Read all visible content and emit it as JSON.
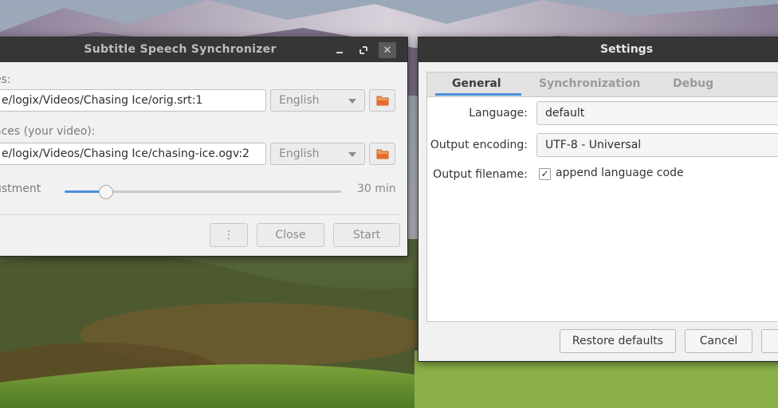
{
  "sync_window": {
    "title": "Subtitle Speech Synchronizer",
    "subtitles_label": "es:",
    "subtitles_path": "e/logix/Videos/Chasing Ice/orig.srt:1",
    "subtitles_language": "English",
    "references_label": "aces (your video):",
    "references_path": "e/logix/Videos/Chasing Ice/chasing-ice.ogv:2",
    "references_language": "English",
    "adjustment_label": "ustment",
    "adjustment_value": "30 min",
    "adjustment_level": 0.15,
    "more_label": "⋮",
    "close_label": "Close",
    "start_label": "Start"
  },
  "settings_window": {
    "title": "Settings",
    "tabs": [
      {
        "label": "General",
        "active": true
      },
      {
        "label": "Synchronization",
        "active": false
      },
      {
        "label": "Debug",
        "active": false
      }
    ],
    "language_label": "Language:",
    "language_value": "default",
    "encoding_label": "Output encoding:",
    "encoding_value": "UTF-8 - Universal",
    "filename_label": "Output filename:",
    "filename_option": "append language code",
    "filename_checked": true,
    "restore_label": "Restore defaults",
    "cancel_label": "Cancel"
  },
  "colors": {
    "titlebar": "#363636",
    "accent": "#4a90d9",
    "window_bg": "#f1f1f1"
  }
}
